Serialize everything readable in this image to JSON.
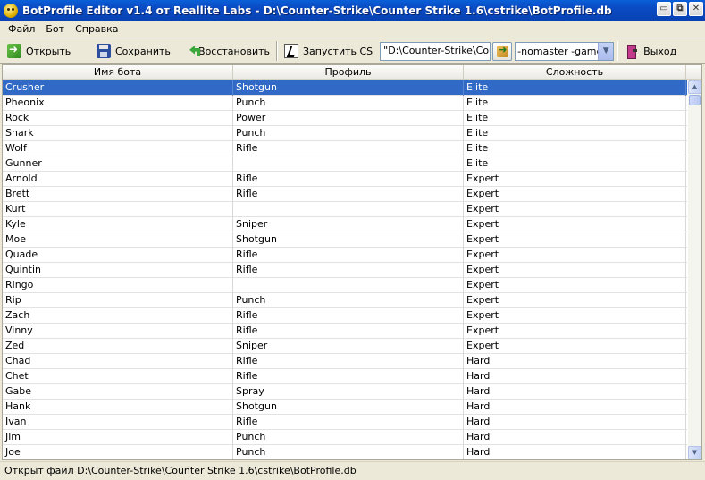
{
  "window": {
    "title": "BotProfile Editor v1.4 от Reallite Labs - D:\\Counter-Strike\\Counter Strike 1.6\\cstrike\\BotProfile.db",
    "minimize_label": "▭",
    "maximize_label": "⧉",
    "close_label": "✕"
  },
  "menu": [
    "Файл",
    "Бот",
    "Справка"
  ],
  "toolbar": {
    "open_label": "Открыть",
    "save_label": "Сохранить",
    "restore_label": "Восстановить",
    "run_label": "Запустить CS",
    "path_value": "\"D:\\Counter-Strike\\Counter",
    "params_value": "-nomaster -game cs",
    "exit_label": "Выход"
  },
  "table": {
    "columns": [
      "Имя бота",
      "Профиль",
      "Сложность"
    ],
    "rows": [
      [
        "Crusher",
        "Shotgun",
        "Elite"
      ],
      [
        "Pheonix",
        "Punch",
        "Elite"
      ],
      [
        "Rock",
        "Power",
        "Elite"
      ],
      [
        "Shark",
        "Punch",
        "Elite"
      ],
      [
        "Wolf",
        "Rifle",
        "Elite"
      ],
      [
        "Gunner",
        "",
        "Elite"
      ],
      [
        "Arnold",
        "Rifle",
        "Expert"
      ],
      [
        "Brett",
        "Rifle",
        "Expert"
      ],
      [
        "Kurt",
        "",
        "Expert"
      ],
      [
        "Kyle",
        "Sniper",
        "Expert"
      ],
      [
        "Moe",
        "Shotgun",
        "Expert"
      ],
      [
        "Quade",
        "Rifle",
        "Expert"
      ],
      [
        "Quintin",
        "Rifle",
        "Expert"
      ],
      [
        "Ringo",
        "",
        "Expert"
      ],
      [
        "Rip",
        "Punch",
        "Expert"
      ],
      [
        "Zach",
        "Rifle",
        "Expert"
      ],
      [
        "Vinny",
        "Rifle",
        "Expert"
      ],
      [
        "Zed",
        "Sniper",
        "Expert"
      ],
      [
        "Chad",
        "Rifle",
        "Hard"
      ],
      [
        "Chet",
        "Rifle",
        "Hard"
      ],
      [
        "Gabe",
        "Spray",
        "Hard"
      ],
      [
        "Hank",
        "Shotgun",
        "Hard"
      ],
      [
        "Ivan",
        "Rifle",
        "Hard"
      ],
      [
        "Jim",
        "Punch",
        "Hard"
      ],
      [
        "Joe",
        "Punch",
        "Hard"
      ]
    ],
    "selected_index": 0
  },
  "status": {
    "text": "Открыт файл D:\\Counter-Strike\\Counter Strike 1.6\\cstrike\\BotProfile.db"
  },
  "colors": {
    "titlebar": "#0a4ac2",
    "selection": "#3169c6",
    "chrome": "#ece9d8"
  }
}
